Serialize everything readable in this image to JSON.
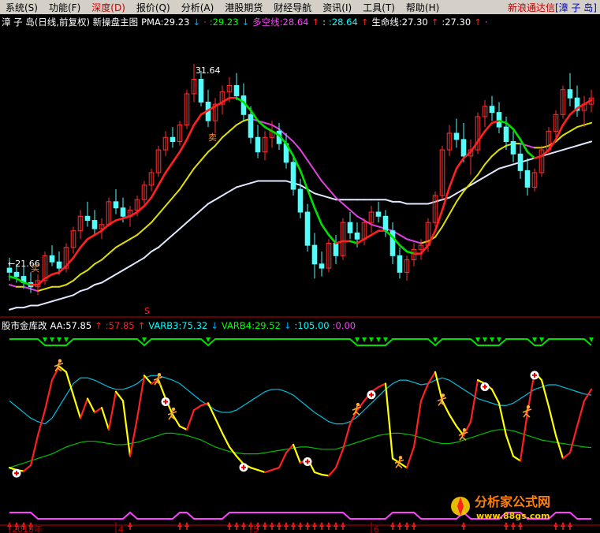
{
  "menu": {
    "items": [
      "系统(S)",
      "功能(F)",
      "深度(D)",
      "报价(Q)",
      "分析(A)",
      "港股期货",
      "财经导航",
      "资讯(I)",
      "工具(T)",
      "帮助(H)"
    ],
    "active_index": 2,
    "brand": "新浪通达信",
    "stock": "[漳 子 岛]"
  },
  "chart_data": [
    {
      "type": "line",
      "panel": "main",
      "title_parts": [
        {
          "text": "漳 子 岛(日线,前复权) 新操盘主图",
          "color": "#ffffff"
        },
        {
          "text": "PMA:29.23",
          "color": "#ffffff"
        },
        {
          "text": "↓",
          "color": "#00a8ff"
        },
        {
          "text": "·",
          "color": "#ff4040"
        },
        {
          "text": ":29.23",
          "color": "#00ff00"
        },
        {
          "text": "↓",
          "color": "#00a8ff"
        },
        {
          "text": "多空线:28.64",
          "color": "#ff40ff"
        },
        {
          "text": "↑",
          "color": "#ff2020"
        },
        {
          "text": ":",
          "color": "#ffffff"
        },
        {
          "text": ":28.64",
          "color": "#00ffff"
        },
        {
          "text": "↑",
          "color": "#ff2020"
        },
        {
          "text": "生命线:27.30",
          "color": "#ffffff"
        },
        {
          "text": "↑",
          "color": "#ff2020"
        },
        {
          "text": ":27.30",
          "color": "#ffffff"
        },
        {
          "text": "↑",
          "color": "#ff2020"
        },
        {
          "text": "·",
          "color": "#ff40ff"
        }
      ],
      "annotations": [
        "31.64",
        "←21.66",
        "S",
        "买",
        "卖"
      ],
      "price_range": [
        19.6,
        33.2
      ],
      "candles": [
        [
          21.8,
          22.3,
          21.2,
          21.6
        ],
        [
          21.6,
          22.0,
          21.1,
          21.4
        ],
        [
          21.4,
          21.9,
          20.8,
          21.1
        ],
        [
          21.1,
          21.6,
          20.6,
          20.9
        ],
        [
          20.9,
          21.5,
          20.5,
          21.2
        ],
        [
          21.2,
          22.6,
          21.0,
          22.4
        ],
        [
          22.4,
          22.9,
          21.9,
          22.1
        ],
        [
          22.1,
          22.6,
          21.5,
          21.8
        ],
        [
          21.8,
          23.0,
          21.6,
          22.8
        ],
        [
          22.8,
          23.8,
          22.5,
          23.6
        ],
        [
          23.6,
          24.6,
          23.2,
          24.3
        ],
        [
          24.3,
          25.0,
          23.8,
          24.1
        ],
        [
          24.1,
          24.6,
          23.4,
          23.7
        ],
        [
          23.7,
          24.2,
          23.2,
          23.9
        ],
        [
          23.9,
          25.2,
          23.8,
          25.0
        ],
        [
          25.0,
          25.6,
          24.4,
          24.7
        ],
        [
          24.7,
          25.2,
          24.0,
          24.3
        ],
        [
          24.3,
          24.8,
          23.8,
          24.6
        ],
        [
          24.6,
          25.3,
          24.3,
          25.1
        ],
        [
          25.1,
          26.0,
          24.9,
          25.8
        ],
        [
          25.8,
          26.6,
          25.5,
          26.4
        ],
        [
          26.4,
          27.7,
          26.2,
          27.5
        ],
        [
          27.5,
          28.4,
          27.2,
          28.1
        ],
        [
          28.1,
          28.6,
          27.6,
          27.9
        ],
        [
          27.9,
          28.9,
          27.7,
          28.7
        ],
        [
          28.7,
          30.4,
          28.5,
          30.2
        ],
        [
          30.2,
          31.64,
          29.8,
          30.9
        ],
        [
          30.9,
          31.3,
          29.6,
          29.8
        ],
        [
          29.8,
          30.4,
          28.6,
          28.9
        ],
        [
          28.9,
          30.0,
          28.3,
          29.7
        ],
        [
          29.7,
          30.6,
          29.2,
          30.3
        ],
        [
          30.3,
          31.0,
          29.8,
          30.6
        ],
        [
          30.6,
          31.2,
          29.9,
          30.1
        ],
        [
          30.1,
          30.7,
          28.9,
          29.2
        ],
        [
          29.2,
          29.6,
          27.8,
          28.1
        ],
        [
          28.1,
          28.7,
          27.1,
          27.4
        ],
        [
          27.4,
          28.4,
          27.0,
          28.1
        ],
        [
          28.1,
          28.9,
          27.6,
          28.4
        ],
        [
          28.4,
          28.8,
          27.5,
          27.8
        ],
        [
          27.8,
          28.3,
          26.6,
          26.9
        ],
        [
          26.9,
          27.3,
          25.3,
          25.6
        ],
        [
          25.6,
          26.1,
          24.2,
          24.5
        ],
        [
          24.5,
          24.9,
          22.6,
          22.9
        ],
        [
          22.9,
          23.5,
          21.3,
          22.0
        ],
        [
          22.0,
          22.6,
          21.4,
          21.8
        ],
        [
          21.8,
          23.2,
          21.6,
          23.0
        ],
        [
          23.0,
          23.4,
          22.0,
          22.4
        ],
        [
          22.4,
          24.2,
          22.2,
          24.0
        ],
        [
          24.0,
          24.5,
          23.2,
          23.5
        ],
        [
          23.5,
          24.0,
          22.8,
          23.2
        ],
        [
          23.2,
          24.2,
          22.9,
          24.0
        ],
        [
          24.0,
          24.8,
          23.5,
          24.5
        ],
        [
          24.5,
          25.0,
          24.0,
          24.3
        ],
        [
          24.3,
          24.6,
          23.3,
          23.6
        ],
        [
          23.6,
          24.0,
          22.0,
          22.4
        ],
        [
          22.4,
          22.8,
          21.3,
          21.6
        ],
        [
          21.6,
          22.4,
          21.2,
          22.2
        ],
        [
          22.2,
          23.0,
          21.9,
          22.7
        ],
        [
          22.7,
          23.2,
          22.2,
          22.9
        ],
        [
          22.9,
          24.2,
          22.6,
          24.0
        ],
        [
          24.0,
          25.5,
          23.8,
          25.3
        ],
        [
          25.3,
          27.7,
          25.1,
          27.5
        ],
        [
          27.5,
          28.7,
          27.2,
          28.3
        ],
        [
          28.3,
          29.0,
          27.6,
          28.0
        ],
        [
          28.0,
          28.8,
          26.9,
          27.2
        ],
        [
          27.2,
          28.0,
          26.3,
          27.5
        ],
        [
          27.5,
          29.3,
          27.3,
          29.1
        ],
        [
          29.1,
          29.9,
          28.6,
          29.6
        ],
        [
          29.6,
          30.1,
          28.9,
          29.3
        ],
        [
          29.3,
          29.8,
          28.3,
          28.6
        ],
        [
          28.6,
          29.1,
          27.5,
          27.9
        ],
        [
          27.9,
          28.4,
          26.9,
          27.3
        ],
        [
          27.3,
          27.8,
          26.1,
          26.5
        ],
        [
          26.5,
          27.1,
          25.3,
          25.7
        ],
        [
          25.7,
          26.6,
          25.5,
          26.4
        ],
        [
          26.4,
          27.7,
          26.2,
          27.5
        ],
        [
          27.5,
          28.6,
          27.3,
          28.4
        ],
        [
          28.4,
          29.4,
          28.1,
          29.2
        ],
        [
          29.2,
          30.6,
          29.0,
          30.4
        ],
        [
          30.4,
          31.2,
          29.6,
          30.0
        ],
        [
          30.0,
          30.6,
          29.1,
          29.4
        ],
        [
          29.4,
          30.1,
          28.6,
          29.7
        ],
        [
          29.7,
          30.4,
          29.3,
          30.0
        ]
      ],
      "series": [
        {
          "role": "fast",
          "values": [
            21.4,
            21.3,
            21.1,
            21.0,
            21.0,
            21.3,
            21.5,
            21.6,
            21.9,
            22.3,
            22.8,
            23.2,
            23.4,
            23.6,
            23.9,
            24.1,
            24.2,
            24.3,
            24.5,
            24.8,
            25.2,
            25.8,
            26.4,
            26.9,
            27.4,
            28.0,
            28.7,
            29.2,
            29.4,
            29.6,
            29.8,
            30.0,
            30.0,
            29.8,
            29.4,
            28.9,
            28.6,
            28.4,
            28.2,
            27.8,
            27.2,
            26.5,
            25.6,
            24.7,
            23.9,
            23.4,
            23.0,
            23.1,
            23.1,
            23.0,
            23.2,
            23.4,
            23.6,
            23.6,
            23.3,
            22.9,
            22.6,
            22.5,
            22.5,
            22.9,
            23.6,
            24.6,
            25.7,
            26.6,
            27.1,
            27.4,
            27.9,
            28.4,
            28.8,
            28.9,
            28.8,
            28.5,
            28.0,
            27.4,
            27.1,
            27.2,
            27.5,
            28.0,
            28.7,
            29.2,
            29.5,
            29.7,
            29.9
          ]
        },
        {
          "role": "slow",
          "values": [
            21.0,
            20.9,
            20.9,
            20.8,
            20.7,
            20.8,
            20.9,
            20.9,
            21.0,
            21.2,
            21.5,
            21.7,
            22.0,
            22.2,
            22.5,
            22.8,
            23.0,
            23.2,
            23.4,
            23.7,
            24.0,
            24.4,
            24.8,
            25.2,
            25.6,
            26.1,
            26.6,
            27.0,
            27.4,
            27.7,
            28.1,
            28.4,
            28.7,
            28.9,
            29.0,
            28.9,
            28.8,
            28.7,
            28.5,
            28.2,
            27.9,
            27.5,
            27.0,
            26.5,
            26.0,
            25.6,
            25.2,
            24.9,
            24.6,
            24.3,
            24.1,
            23.9,
            23.8,
            23.7,
            23.6,
            23.4,
            23.2,
            23.1,
            23.0,
            23.1,
            23.3,
            23.8,
            24.4,
            25.0,
            25.5,
            25.9,
            26.3,
            26.8,
            27.2,
            27.5,
            27.7,
            27.8,
            27.8,
            27.7,
            27.6,
            27.6,
            27.7,
            27.9,
            28.2,
            28.4,
            28.6,
            28.7,
            28.8
          ]
        },
        {
          "role": "life",
          "values": [
            19.8,
            19.9,
            19.9,
            20.0,
            20.0,
            20.1,
            20.2,
            20.3,
            20.4,
            20.5,
            20.7,
            20.8,
            21.0,
            21.1,
            21.3,
            21.5,
            21.7,
            21.9,
            22.1,
            22.3,
            22.6,
            22.8,
            23.1,
            23.4,
            23.7,
            24.0,
            24.3,
            24.6,
            24.9,
            25.1,
            25.3,
            25.5,
            25.7,
            25.8,
            25.9,
            26.0,
            26.0,
            26.0,
            26.0,
            26.0,
            25.9,
            25.8,
            25.6,
            25.4,
            25.3,
            25.2,
            25.1,
            25.1,
            25.1,
            25.1,
            25.1,
            25.1,
            25.1,
            25.1,
            25.0,
            25.0,
            24.9,
            24.9,
            24.9,
            24.9,
            25.0,
            25.1,
            25.2,
            25.4,
            25.6,
            25.8,
            26.0,
            26.2,
            26.4,
            26.6,
            26.7,
            26.8,
            26.9,
            27.0,
            27.1,
            27.2,
            27.3,
            27.4,
            27.5,
            27.6,
            27.7,
            27.8,
            27.9
          ]
        }
      ]
    },
    {
      "type": "line",
      "panel": "indicator",
      "title_parts": [
        {
          "text": "股市金库改",
          "color": "#ffffff"
        },
        {
          "text": "AA:57.85",
          "color": "#ffffff"
        },
        {
          "text": "↑",
          "color": "#ff2020"
        },
        {
          "text": ":57.85",
          "color": "#ff2020"
        },
        {
          "text": "↑",
          "color": "#ff2020"
        },
        {
          "text": "VARB3:75.32",
          "color": "#00ffff"
        },
        {
          "text": "↓",
          "color": "#00a8ff"
        },
        {
          "text": "VARB4:29.52",
          "color": "#00ff00"
        },
        {
          "text": "↓",
          "color": "#00a8ff"
        },
        {
          "text": ":105.00",
          "color": "#00ffff"
        },
        {
          "text": ":0.00",
          "color": "#ff40ff"
        }
      ],
      "y_range": [
        -5,
        110
      ],
      "aa": [
        12,
        10,
        9,
        14,
        40,
        62,
        88,
        100,
        95,
        75,
        55,
        72,
        60,
        64,
        45,
        78,
        70,
        22,
        55,
        92,
        85,
        88,
        72,
        58,
        48,
        45,
        62,
        66,
        68,
        55,
        42,
        30,
        22,
        15,
        12,
        10,
        8,
        10,
        12,
        25,
        32,
        16,
        20,
        8,
        6,
        5,
        12,
        28,
        50,
        62,
        70,
        78,
        82,
        85,
        20,
        16,
        12,
        30,
        70,
        85,
        95,
        70,
        58,
        48,
        40,
        52,
        88,
        85,
        80,
        68,
        40,
        22,
        18,
        60,
        95,
        88,
        65,
        40,
        20,
        25,
        48,
        70,
        80
      ],
      "varb3": [
        70,
        65,
        60,
        55,
        52,
        50,
        55,
        65,
        75,
        85,
        90,
        90,
        88,
        85,
        82,
        80,
        80,
        82,
        85,
        90,
        92,
        92,
        90,
        88,
        85,
        80,
        75,
        70,
        66,
        62,
        60,
        60,
        62,
        66,
        70,
        74,
        78,
        80,
        80,
        78,
        75,
        70,
        65,
        60,
        56,
        52,
        50,
        50,
        52,
        56,
        62,
        68,
        74,
        80,
        85,
        88,
        88,
        86,
        84,
        85,
        88,
        90,
        88,
        84,
        80,
        76,
        72,
        70,
        68,
        66,
        66,
        68,
        72,
        76,
        80,
        82,
        84,
        84,
        82,
        80,
        78,
        76,
        75
      ],
      "varb4": [
        12,
        14,
        16,
        18,
        20,
        22,
        24,
        27,
        30,
        32,
        34,
        35,
        35,
        34,
        33,
        32,
        32,
        33,
        34,
        36,
        38,
        40,
        42,
        42,
        41,
        40,
        38,
        36,
        33,
        30,
        28,
        26,
        25,
        24,
        24,
        24,
        25,
        26,
        27,
        28,
        29,
        30,
        30,
        29,
        28,
        28,
        28,
        30,
        32,
        34,
        36,
        38,
        40,
        41,
        42,
        42,
        41,
        40,
        38,
        36,
        34,
        33,
        33,
        34,
        36,
        38,
        40,
        42,
        44,
        45,
        45,
        44,
        42,
        40,
        38,
        36,
        35,
        34,
        33,
        32,
        31,
        30,
        29.5
      ],
      "buy_markers": [
        1,
        22,
        33,
        42,
        51,
        67,
        74
      ],
      "sell_markers": [
        7,
        21,
        23,
        49,
        55,
        61,
        64,
        73
      ]
    }
  ],
  "bottom_axis": {
    "labels": [
      {
        "i": 0,
        "text": "2010年"
      },
      {
        "i": 15,
        "text": "4"
      },
      {
        "i": 34,
        "text": "5"
      },
      {
        "i": 51,
        "text": "6"
      }
    ]
  },
  "watermark": {
    "title": "分析家公式网",
    "url": "www.88gs.com"
  },
  "colors": {
    "up": "#ff3030",
    "down": "#54fcfc",
    "fast_up": "#ff2020",
    "fast_down": "#00e000",
    "slow": "#e0e000",
    "magenta": "#e040e0",
    "life": "#e0e8ff",
    "ind_up": "#ff2020",
    "ind_down": "#ffff00",
    "varb3": "#00c0e0",
    "varb4": "#00c000"
  }
}
